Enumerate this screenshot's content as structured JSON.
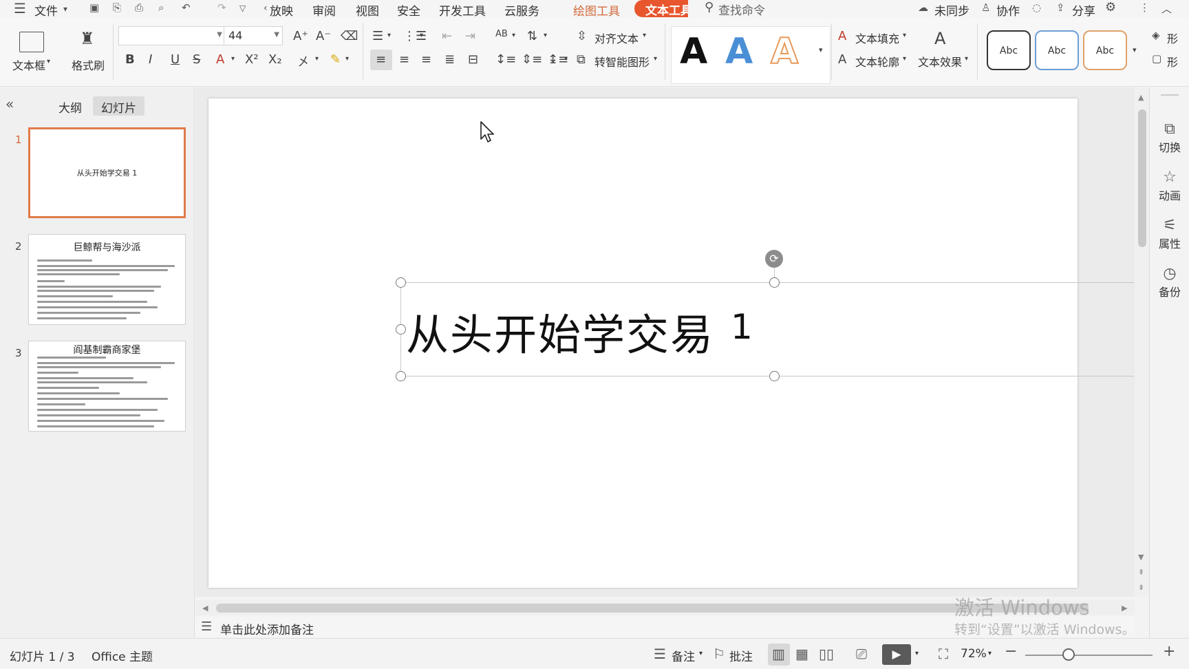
{
  "menubar": {
    "file_label": "文件",
    "tabs": [
      "放映",
      "审阅",
      "视图",
      "安全",
      "开发工具",
      "云服务"
    ],
    "drawing_tools": "绘图工具",
    "text_tools": "文本工具",
    "search_placeholder": "查找命令",
    "sync": "未同步",
    "collab": "协作",
    "share": "分享"
  },
  "ribbon": {
    "textbox": "文本框",
    "format_painter": "格式刷",
    "font_name": "",
    "font_size": "44",
    "align_text": "对齐文本",
    "smart_art": "转智能图形",
    "text_fill": "文本填充",
    "text_outline": "文本轮廓",
    "text_effect": "文本效果",
    "glyph": "A",
    "style_sample": "Abc",
    "shape_fill_partial": "形",
    "shape_outline_partial": "形",
    "colors": {
      "black": "#111111",
      "blue": "#4a8fd6",
      "orange": "#e89a5a"
    }
  },
  "leftpane": {
    "tab_outline": "大纲",
    "tab_slides": "幻灯片",
    "slides": [
      {
        "num": "1",
        "title": "从头开始学交易 1"
      },
      {
        "num": "2",
        "title": "巨鲸帮与海沙派"
      },
      {
        "num": "3",
        "title": "阎基制霸商家堡"
      }
    ]
  },
  "slide": {
    "title": "从头开始学交易",
    "number": "1"
  },
  "notes": {
    "placeholder": "单击此处添加备注"
  },
  "watermark": {
    "line1": "激活 Windows",
    "line2": "转到“设置”以激活 Windows。"
  },
  "rightpanel": {
    "items": [
      "切换",
      "动画",
      "属性",
      "备份"
    ]
  },
  "statusbar": {
    "slide_info": "幻灯片 1 / 3",
    "theme": "Office 主题",
    "notes": "备注",
    "comments": "批注",
    "zoom": "72%"
  }
}
